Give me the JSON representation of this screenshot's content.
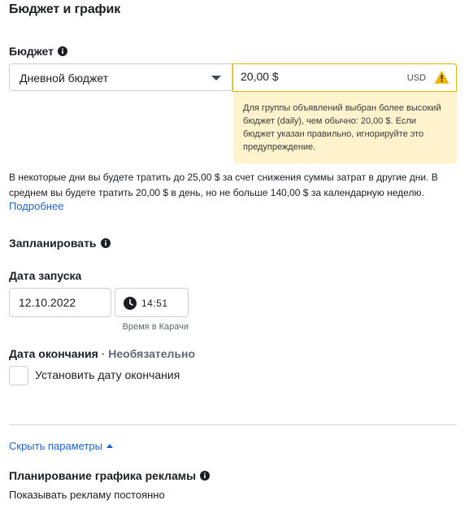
{
  "section": {
    "title": "Бюджет и график"
  },
  "budget": {
    "label": "Бюджет",
    "type_selected": "Дневной бюджет",
    "amount_value": "20,00 $",
    "currency": "USD",
    "warning_text": "Для группы объявлений выбран более высокий бюджет (daily), чем обычно: 20,00 $. Если бюджет указан правильно, игнорируйте это предупреждение.",
    "note": "В некоторые дни вы будете тратить до 25,00 $ за счет снижения суммы затрат в другие дни. В среднем вы будете тратить 20,00 $ в день, но не больше 140,00 $ за календарную неделю.",
    "more_link": "Подробнее"
  },
  "schedule": {
    "label": "Запланировать",
    "start_label": "Дата запуска",
    "start_date": "12.10.2022",
    "start_time": "14:51",
    "timezone": "Время в Карачи",
    "end_label": "Дата окончания",
    "end_optional": " · Необязательно",
    "set_end_label": "Установить дату окончания"
  },
  "advanced": {
    "toggle_label": "Скрыть параметры",
    "ad_scheduling_label": "Планирование графика рекламы",
    "ad_scheduling_value": "Показывать рекламу постоянно"
  },
  "colors": {
    "link": "#1d64cc",
    "warning_border": "#e2b400",
    "warning_bg": "#fff3cd",
    "warning_icon": "#f0b400"
  },
  "icons": {
    "info": "info-icon",
    "caret": "caret-down-icon",
    "warning": "warning-icon",
    "clock": "clock-icon",
    "chevron_up": "chevron-up-icon"
  }
}
